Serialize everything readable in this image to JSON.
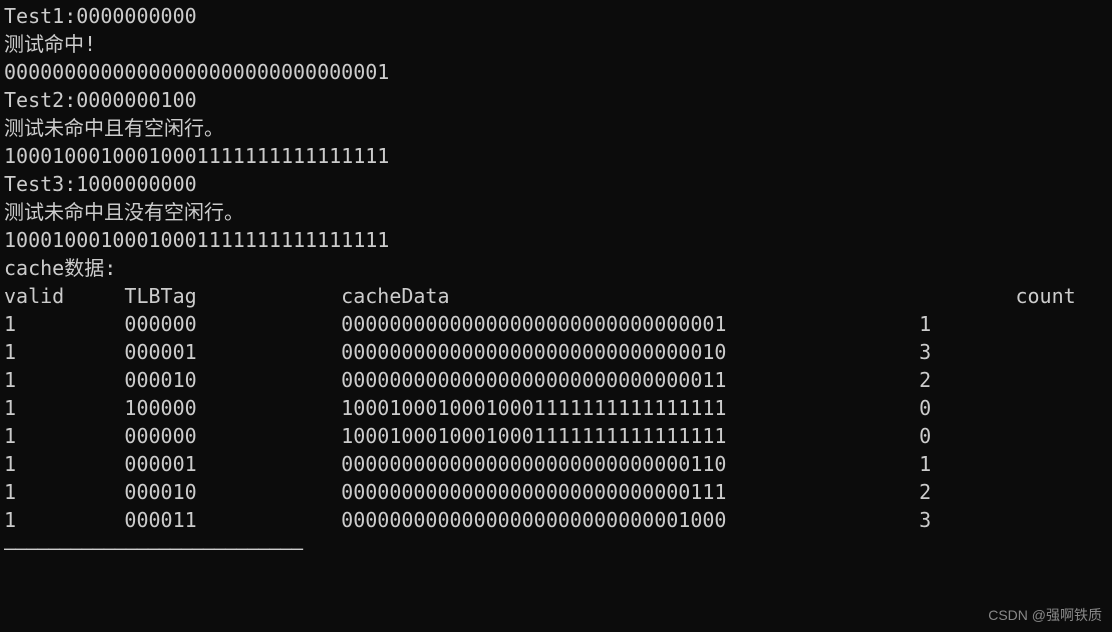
{
  "lines": {
    "test1_header": "Test1:0000000000",
    "test1_msg": "测试命中!",
    "test1_data": "00000000000000000000000000000001",
    "test2_header": "Test2:0000000100",
    "test2_msg": "测试未命中且有空闲行。",
    "test2_data": "10001000100010001111111111111111",
    "test3_header": "Test3:1000000000",
    "test3_msg": "测试未命中且没有空闲行。",
    "test3_data": "10001000100010001111111111111111",
    "blank": "",
    "cache_title": "cache数据:"
  },
  "table": {
    "header": {
      "valid": "valid",
      "tlbtag": "TLBTag",
      "cachedata": "cacheData",
      "count": "count"
    },
    "rows": [
      {
        "valid": "1",
        "tlbtag": "000000",
        "cachedata": "00000000000000000000000000000001",
        "count": "1"
      },
      {
        "valid": "1",
        "tlbtag": "000001",
        "cachedata": "00000000000000000000000000000010",
        "count": "3"
      },
      {
        "valid": "1",
        "tlbtag": "000010",
        "cachedata": "00000000000000000000000000000011",
        "count": "2"
      },
      {
        "valid": "1",
        "tlbtag": "100000",
        "cachedata": "10001000100010001111111111111111",
        "count": "0"
      },
      {
        "valid": "1",
        "tlbtag": "000000",
        "cachedata": "10001000100010001111111111111111",
        "count": "0"
      },
      {
        "valid": "1",
        "tlbtag": "000001",
        "cachedata": "00000000000000000000000000000110",
        "count": "1"
      },
      {
        "valid": "1",
        "tlbtag": "000010",
        "cachedata": "00000000000000000000000000000111",
        "count": "2"
      },
      {
        "valid": "1",
        "tlbtag": "000011",
        "cachedata": "00000000000000000000000000001000",
        "count": "3"
      }
    ]
  },
  "separator": "———————————————————————————",
  "watermark": "CSDN @强啊铁质"
}
